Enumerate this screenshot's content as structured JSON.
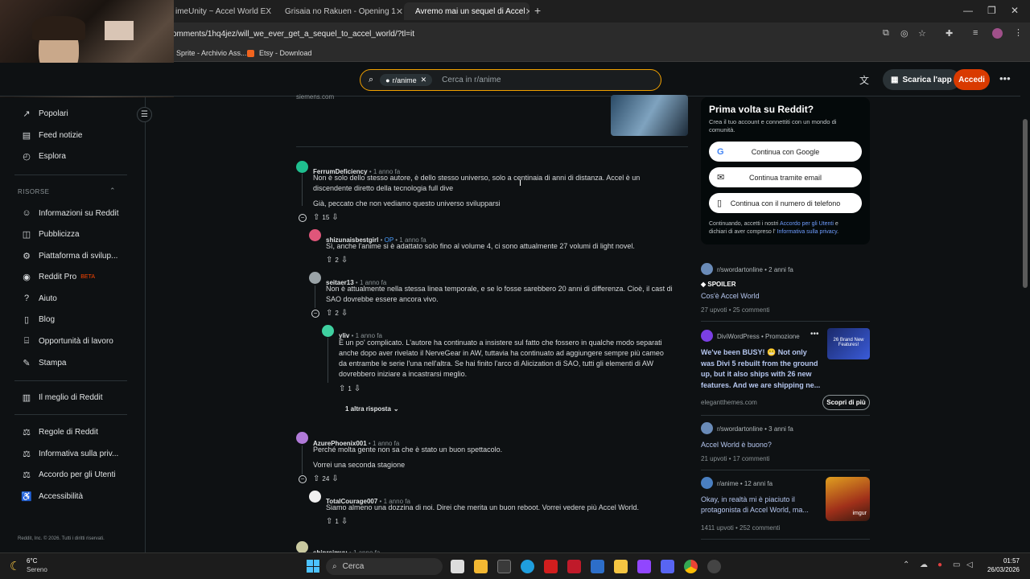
{
  "browser": {
    "tabs": [
      {
        "label": "imeUnity ~ Accel World EX S"
      },
      {
        "label": "Grisaia no Rakuen - Opening 1"
      },
      {
        "label": "Avremo mai un sequel di Accel"
      }
    ],
    "url": "omments/1hq4jez/will_we_ever_get_a_sequel_to_accel_world/?tl=it",
    "bookmarks": [
      "Sprite - Archivio Ass...",
      "Etsy - Download"
    ]
  },
  "header": {
    "search_chip": "r/anime",
    "search_placeholder": "Cerca in r/anime",
    "app_button": "Scarica l'app",
    "login_button": "Accedi"
  },
  "sidebar": {
    "items_top": [
      {
        "label": "Popolari",
        "icon": "popular-icon"
      },
      {
        "label": "Feed notizie",
        "icon": "news-icon"
      },
      {
        "label": "Esplora",
        "icon": "explore-icon"
      }
    ],
    "resources_title": "RISORSE",
    "resources": [
      {
        "label": "Informazioni su Reddit",
        "icon": "reddit-icon"
      },
      {
        "label": "Pubblicizza",
        "icon": "ads-icon"
      },
      {
        "label": "Piattaforma di svilup...",
        "icon": "dev-icon"
      },
      {
        "label": "Reddit Pro",
        "icon": "pro-icon",
        "badge": "BETA"
      },
      {
        "label": "Aiuto",
        "icon": "help-icon"
      },
      {
        "label": "Blog",
        "icon": "blog-icon"
      },
      {
        "label": "Opportunità di lavoro",
        "icon": "careers-icon"
      },
      {
        "label": "Stampa",
        "icon": "press-icon"
      }
    ],
    "best_of": "Il meglio di Reddit",
    "policies": [
      {
        "label": "Regole di Reddit"
      },
      {
        "label": "Informativa sulla priv..."
      },
      {
        "label": "Accordo per gli Utenti"
      },
      {
        "label": "Accessibilità"
      }
    ],
    "footer": "Reddit, Inc. © 2026. Tutti i diritti riservati."
  },
  "main": {
    "ad_domain": "siemens.com",
    "comments": [
      {
        "user": "FerrumDeficiency",
        "time": "1 anno fa",
        "body1": "Non è solo dello stesso autore, è dello stesso universo, solo a centinaia di anni di distanza. Accel è un",
        "body2": "discendente diretto della tecnologia full dive",
        "body3": "Già, peccato che non vediamo questo universo svilupparsi",
        "votes": "15"
      },
      {
        "user": "shizunaisbestgirl",
        "op": "OP",
        "time": "1 anno fa",
        "body1": "Sì, anche l'anime si è adattato solo fino al volume 4, ci sono attualmente 27 volumi di light novel.",
        "votes": "2"
      },
      {
        "user": "seitaer13",
        "time": "1 anno fa",
        "body1": "Non è attualmente nella stessa linea temporale, e se lo fosse sarebbero 20 anni di differenza. Cioè, il cast di",
        "body2": "SAO dovrebbe essere ancora vivo.",
        "votes": "2"
      },
      {
        "user": "yliv",
        "time": "1 anno fa",
        "body1": "È un po' complicato. L'autore ha continuato a insistere sul fatto che fossero in qualche modo separati",
        "body2": "anche dopo aver rivelato il NerveGear in AW, tuttavia ha continuato ad aggiungere sempre più cameo",
        "body3": "da entrambe le serie l'una nell'altra. Se hai finito l'arco di Alicization di SAO, tutti gli elementi di AW",
        "body4": "dovrebbero iniziare a incastrarsi meglio.",
        "votes": "1"
      },
      {
        "more": "1 altra risposta"
      },
      {
        "user": "AzurePhoenix001",
        "time": "1 anno fa",
        "body1": "Perché molta gente non sa che è stato un buon spettacolo.",
        "body2": "Vorrei una seconda stagione",
        "votes": "24"
      },
      {
        "user": "TotalCourage007",
        "time": "1 anno fa",
        "body1": "Siamo almeno una dozzina di noi. Direi che merita un buon reboot. Vorrei vedere più Accel World.",
        "votes": "1"
      },
      {
        "user": "shinreimyu",
        "time": "1 anno fa"
      }
    ]
  },
  "right": {
    "signup_title": "Prima volta su Reddit?",
    "signup_text1": "Crea il tuo account e connettiti con un mondo di",
    "signup_text2": "comunità.",
    "google": "Continua con Google",
    "email": "Continua tramite email",
    "phone": "Continua con il numero di telefono",
    "terms1_a": "Continuando, accetti i nostri ",
    "terms1_link": "Accordo per gli Utenti",
    "terms1_b": " e",
    "terms2_a": "dichiari di aver compreso l' ",
    "terms2_link": "Informativa sulla privacy",
    "terms2_b": ".",
    "cards": [
      {
        "sub": "r/swordartonline • 2 anni fa",
        "spoiler": "SPOILER",
        "title": "Cos'è Accel World",
        "stats": "27 upvoti • 25 commenti"
      },
      {
        "sub": "DiviWordPress • Promozione",
        "title1": "We've been BUSY! 😬 Not only",
        "title2": "was Divi 5 rebuilt from the ground",
        "title3": "up, but it also ships with 26 new",
        "title4": "features. And we are shipping ne...",
        "domain": "elegantthemes.com",
        "cta": "Scopri di più",
        "thumb_text": "26 Brand New Features!"
      },
      {
        "sub": "r/swordartonline • 3 anni fa",
        "title": "Accel World è buono?",
        "stats": "21 upvoti • 17 commenti"
      },
      {
        "sub": "r/anime • 12 anni fa",
        "title1": "Okay, in realtà mi è piaciuto il",
        "title2": "protagonista di Accel World, ma...",
        "stats": "1411 upvoti • 252 commenti",
        "thumb_text": "imgur"
      }
    ]
  },
  "taskbar": {
    "weather_temp": "6°C",
    "weather_text": "Sereno",
    "search": "Cerca",
    "time": "01:57",
    "date": "26/03/2026"
  }
}
